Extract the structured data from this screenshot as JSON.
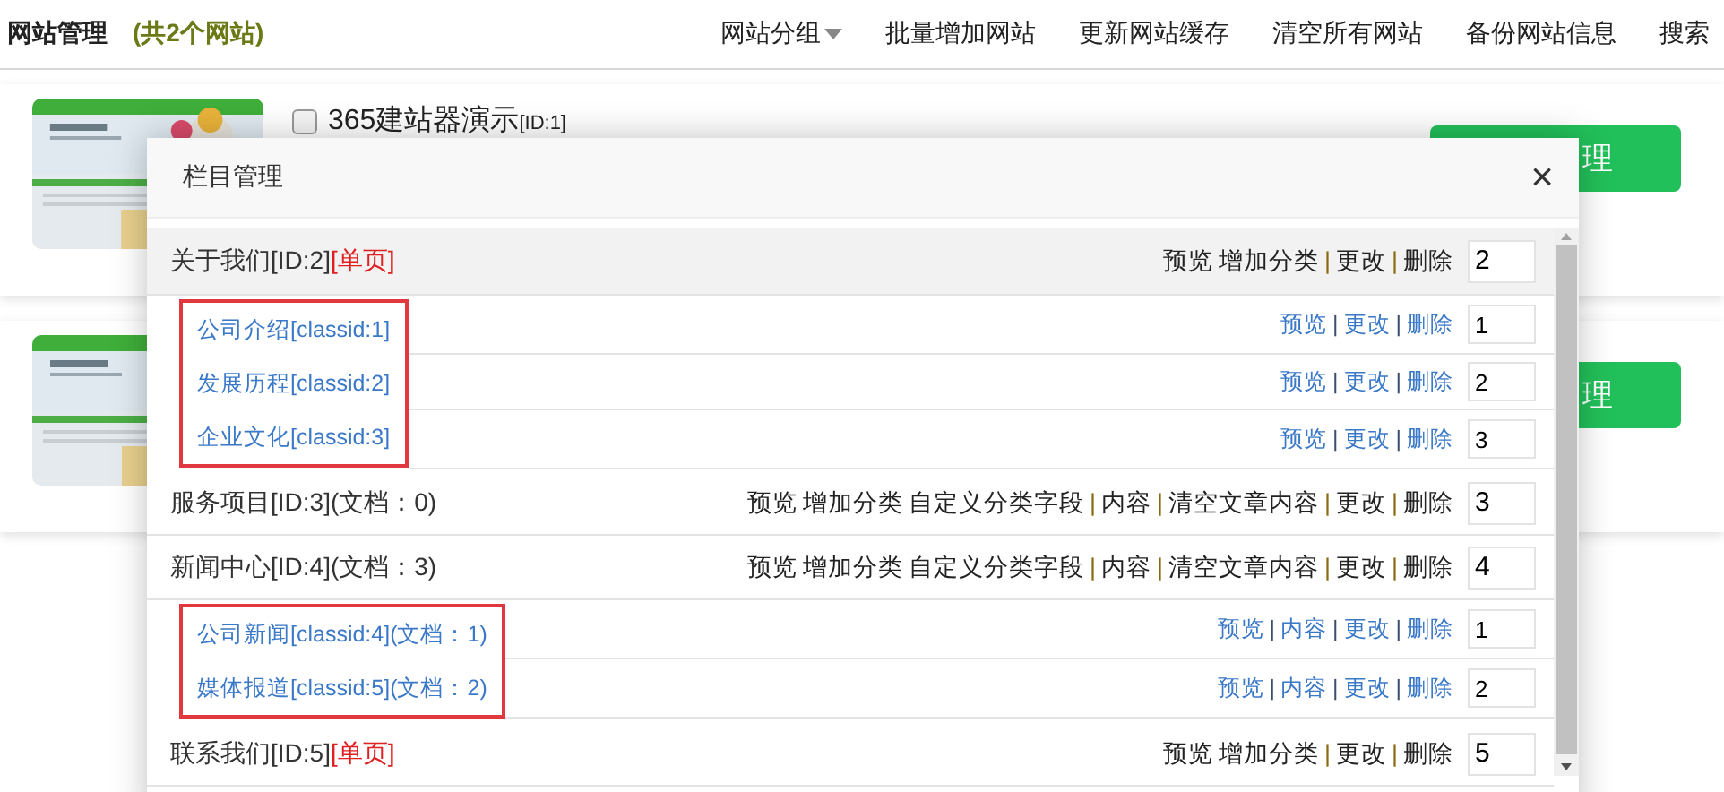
{
  "topbar": {
    "title": "网站管理",
    "count": "(共2个网站)",
    "menu": [
      {
        "label": "网站分组",
        "dropdown": true
      },
      {
        "label": "批量增加网站",
        "dropdown": false
      },
      {
        "label": "更新网站缓存",
        "dropdown": false
      },
      {
        "label": "清空所有网站",
        "dropdown": false
      },
      {
        "label": "备份网站信息",
        "dropdown": false
      },
      {
        "label": "搜索",
        "dropdown": false
      }
    ]
  },
  "sites": [
    {
      "kind": "picture",
      "title": "365建站器演示",
      "id_tag": "[ID:1]",
      "checked": false,
      "button": "理"
    },
    {
      "kind": "picture",
      "button": "理"
    }
  ],
  "dialog": {
    "title": "栏目管理",
    "close": "×",
    "categories": [
      {
        "name": "关于我们[ID:2]",
        "tag": "[单页]",
        "highlighted": true,
        "marked": true,
        "order": "2",
        "actions": [
          {
            "kind": "link",
            "text": "预览"
          },
          {
            "kind": "link",
            "text": "增加分类"
          },
          {
            "kind": "divider",
            "text": "|"
          },
          {
            "kind": "link",
            "text": "更改"
          },
          {
            "kind": "divider",
            "text": "|"
          },
          {
            "kind": "link",
            "text": "删除"
          }
        ],
        "children": [
          {
            "name": "公司介绍[classid:1]",
            "order": "1",
            "actions": [
              {
                "kind": "link",
                "text": "预览"
              },
              {
                "kind": "divider",
                "text": "|"
              },
              {
                "kind": "link",
                "text": "更改"
              },
              {
                "kind": "divider",
                "text": "|"
              },
              {
                "kind": "link",
                "text": "删除"
              }
            ]
          },
          {
            "name": "发展历程[classid:2]",
            "order": "2",
            "actions": [
              {
                "kind": "link",
                "text": "预览"
              },
              {
                "kind": "divider",
                "text": "|"
              },
              {
                "kind": "link",
                "text": "更改"
              },
              {
                "kind": "divider",
                "text": "|"
              },
              {
                "kind": "link",
                "text": "删除"
              }
            ]
          },
          {
            "name": "企业文化[classid:3]",
            "order": "3",
            "actions": [
              {
                "kind": "link",
                "text": "预览"
              },
              {
                "kind": "divider",
                "text": "|"
              },
              {
                "kind": "link",
                "text": "更改"
              },
              {
                "kind": "divider",
                "text": "|"
              },
              {
                "kind": "link",
                "text": "删除"
              }
            ]
          }
        ]
      },
      {
        "name": "服务项目[ID:3](文档：0)",
        "highlighted": false,
        "order": "3",
        "actions": [
          {
            "kind": "link",
            "text": "预览"
          },
          {
            "kind": "link",
            "text": "增加分类"
          },
          {
            "kind": "link",
            "text": "自定义分类字段"
          },
          {
            "kind": "divider",
            "text": "|"
          },
          {
            "kind": "link",
            "text": "内容"
          },
          {
            "kind": "divider",
            "text": "|"
          },
          {
            "kind": "link",
            "text": "清空文章内容"
          },
          {
            "kind": "divider",
            "text": "|"
          },
          {
            "kind": "link",
            "text": "更改"
          },
          {
            "kind": "divider",
            "text": "|"
          },
          {
            "kind": "link",
            "text": "删除"
          }
        ]
      },
      {
        "name": "新闻中心[ID:4](文档：3)",
        "highlighted": false,
        "marked": true,
        "order": "4",
        "actions": [
          {
            "kind": "link",
            "text": "预览"
          },
          {
            "kind": "link",
            "text": "增加分类"
          },
          {
            "kind": "link",
            "text": "自定义分类字段"
          },
          {
            "kind": "divider",
            "text": "|"
          },
          {
            "kind": "link",
            "text": "内容"
          },
          {
            "kind": "divider",
            "text": "|"
          },
          {
            "kind": "link",
            "text": "清空文章内容"
          },
          {
            "kind": "divider",
            "text": "|"
          },
          {
            "kind": "link",
            "text": "更改"
          },
          {
            "kind": "divider",
            "text": "|"
          },
          {
            "kind": "link",
            "text": "删除"
          }
        ],
        "children": [
          {
            "name": "公司新闻[classid:4](文档：1)",
            "order": "1",
            "actions": [
              {
                "kind": "link",
                "text": "预览"
              },
              {
                "kind": "divider",
                "text": "|"
              },
              {
                "kind": "link",
                "text": "内容"
              },
              {
                "kind": "divider",
                "text": "|"
              },
              {
                "kind": "link",
                "text": "更改"
              },
              {
                "kind": "divider",
                "text": "|"
              },
              {
                "kind": "link",
                "text": "删除"
              }
            ]
          },
          {
            "name": "媒体报道[classid:5](文档：2)",
            "order": "2",
            "actions": [
              {
                "kind": "link",
                "text": "预览"
              },
              {
                "kind": "divider",
                "text": "|"
              },
              {
                "kind": "link",
                "text": "内容"
              },
              {
                "kind": "divider",
                "text": "|"
              },
              {
                "kind": "link",
                "text": "更改"
              },
              {
                "kind": "divider",
                "text": "|"
              },
              {
                "kind": "link",
                "text": "删除"
              }
            ]
          }
        ]
      },
      {
        "name": "联系我们[ID:5]",
        "tag": "[单页]",
        "highlighted": false,
        "order": "5",
        "actions": [
          {
            "kind": "link",
            "text": "预览"
          },
          {
            "kind": "link",
            "text": "增加分类"
          },
          {
            "kind": "divider",
            "text": "|"
          },
          {
            "kind": "link",
            "text": "更改"
          },
          {
            "kind": "divider",
            "text": "|"
          },
          {
            "kind": "link",
            "text": "删除"
          }
        ]
      }
    ]
  }
}
